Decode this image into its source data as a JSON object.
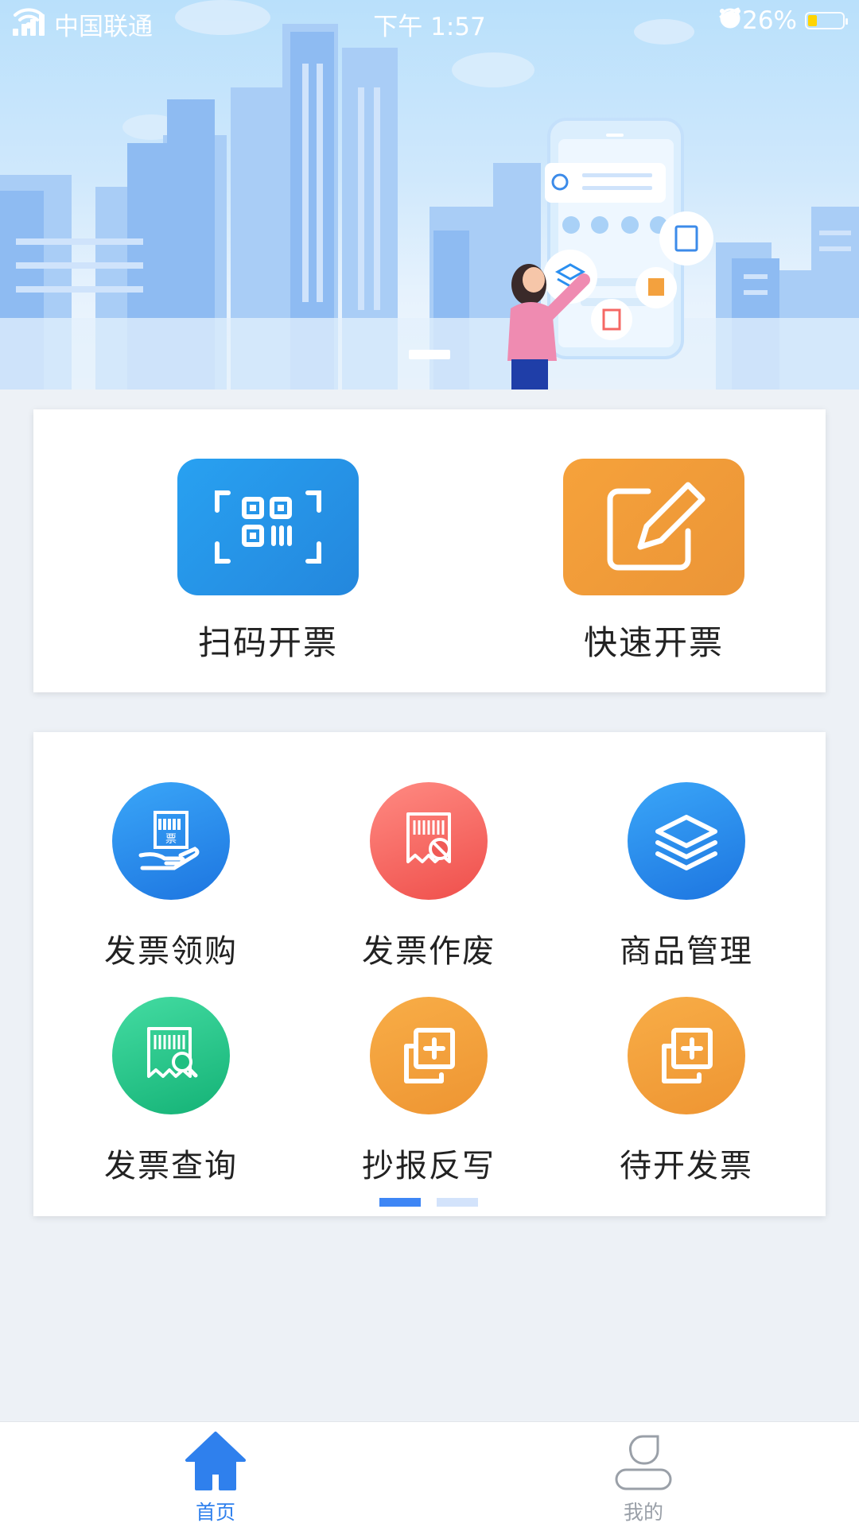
{
  "status_bar": {
    "carrier": "中国联通",
    "time": "下午 1:57",
    "battery": "26%",
    "battery_level": 0.26
  },
  "banner": {
    "slide_count": 1,
    "active_slide": 1
  },
  "quick_actions": [
    {
      "label": "扫码开票",
      "icon": "qr-scan-icon",
      "color": "#2594e8"
    },
    {
      "label": "快速开票",
      "icon": "edit-pencil-icon",
      "color": "#f09a38"
    }
  ],
  "functions": [
    {
      "label": "发票领购",
      "icon": "invoice-purchase-icon",
      "color": "#2a8ff0"
    },
    {
      "label": "发票作废",
      "icon": "invoice-void-icon",
      "color": "#f56864"
    },
    {
      "label": "商品管理",
      "icon": "layers-icon",
      "color": "#2a8ff0"
    },
    {
      "label": "发票查询",
      "icon": "invoice-search-icon",
      "color": "#2ccb8c"
    },
    {
      "label": "抄报反写",
      "icon": "add-copy-icon",
      "color": "#f3a13e"
    },
    {
      "label": "待开发票",
      "icon": "add-copy-icon",
      "color": "#f3a13e"
    }
  ],
  "function_pager": {
    "pages": 2,
    "active": 1,
    "active_color": "#3e86f5",
    "inactive_color": "#d3e3fb"
  },
  "tabbar": {
    "tabs": [
      {
        "label": "首页",
        "icon": "home-icon",
        "active": true
      },
      {
        "label": "我的",
        "icon": "user-icon",
        "active": false
      }
    ],
    "active_color": "#2f80ed",
    "inactive_color": "#9aa0a8"
  }
}
